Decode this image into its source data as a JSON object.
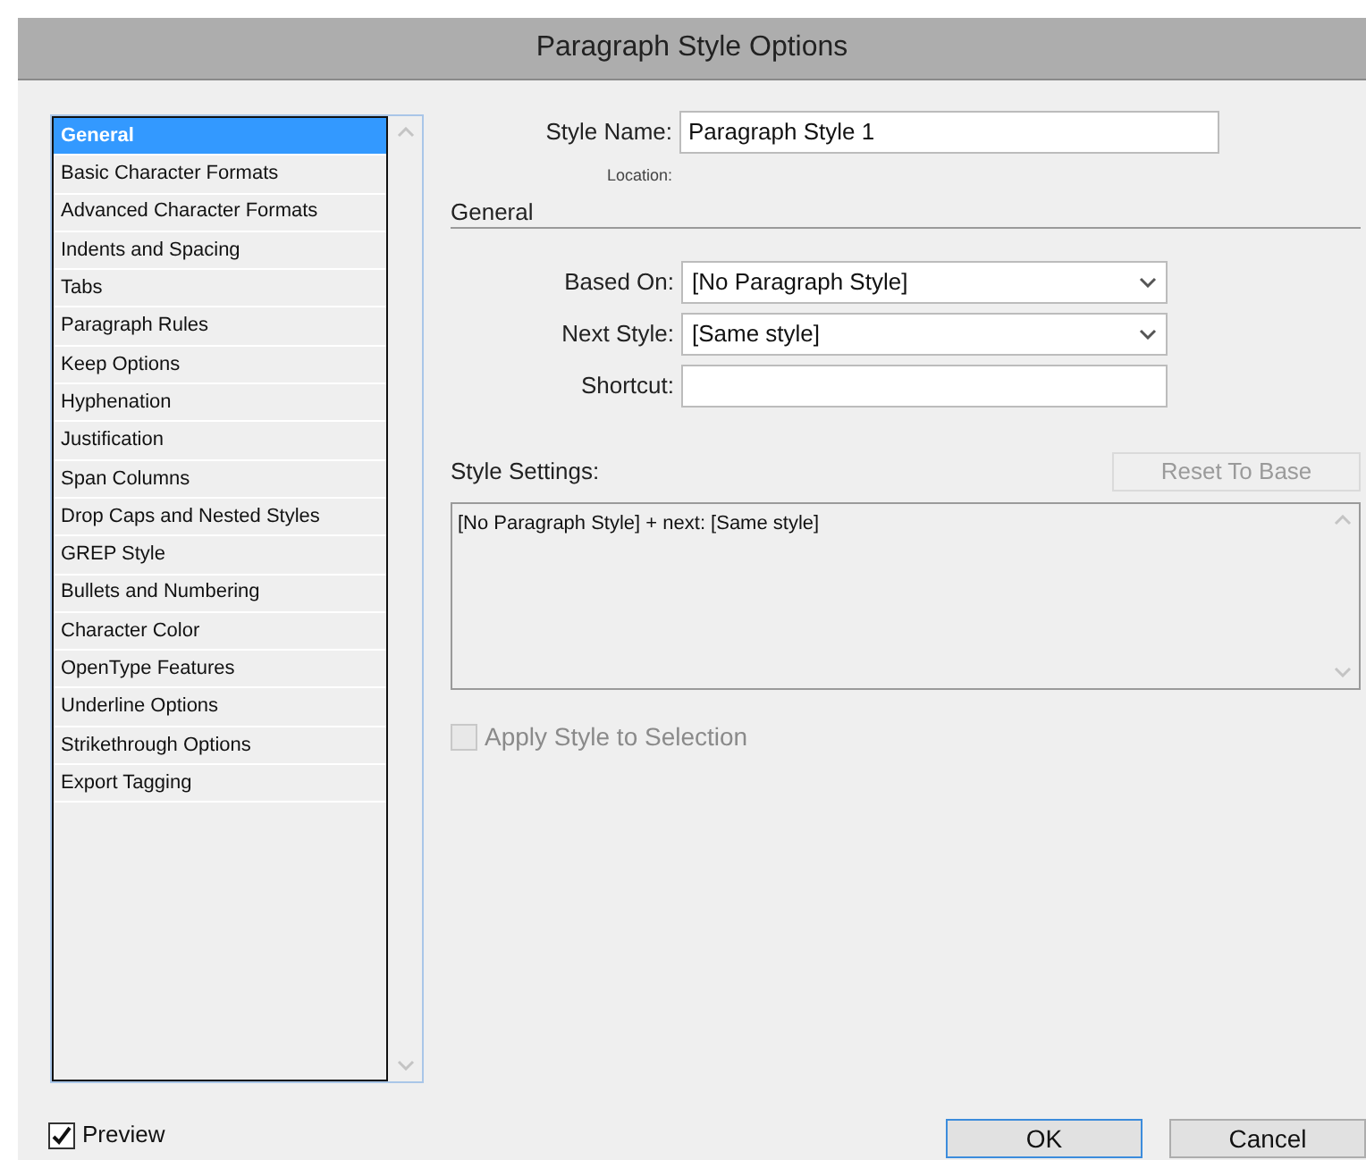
{
  "window": {
    "title": "Paragraph Style Options"
  },
  "sidebar": {
    "items": [
      {
        "label": "General",
        "selected": true
      },
      {
        "label": "Basic Character Formats",
        "selected": false
      },
      {
        "label": "Advanced Character Formats",
        "selected": false
      },
      {
        "label": "Indents and Spacing",
        "selected": false
      },
      {
        "label": "Tabs",
        "selected": false
      },
      {
        "label": "Paragraph Rules",
        "selected": false
      },
      {
        "label": "Keep Options",
        "selected": false
      },
      {
        "label": "Hyphenation",
        "selected": false
      },
      {
        "label": "Justification",
        "selected": false
      },
      {
        "label": "Span Columns",
        "selected": false
      },
      {
        "label": "Drop Caps and Nested Styles",
        "selected": false
      },
      {
        "label": "GREP Style",
        "selected": false
      },
      {
        "label": "Bullets and Numbering",
        "selected": false
      },
      {
        "label": "Character Color",
        "selected": false
      },
      {
        "label": "OpenType Features",
        "selected": false
      },
      {
        "label": "Underline Options",
        "selected": false
      },
      {
        "label": "Strikethrough Options",
        "selected": false
      },
      {
        "label": "Export Tagging",
        "selected": false
      }
    ]
  },
  "style_name": {
    "label": "Style Name:",
    "value": "Paragraph Style 1"
  },
  "location": {
    "label": "Location:"
  },
  "section_title": "General",
  "fields": [
    {
      "kind": "dropdown",
      "label": "Based On:",
      "value": "[No Paragraph Style]"
    },
    {
      "kind": "dropdown",
      "label": "Next Style:",
      "value": "[Same style]"
    },
    {
      "kind": "text",
      "label": "Shortcut:"
    }
  ],
  "style_settings": {
    "label": "Style Settings:",
    "text": "[No Paragraph Style] + next: [Same style]",
    "reset_button": {
      "label": "Reset To Base",
      "disabled": true
    }
  },
  "apply_style": {
    "label": "Apply Style to Selection",
    "checked": false,
    "disabled": true
  },
  "preview": {
    "label": "Preview",
    "checked": true
  },
  "buttons": [
    {
      "label": "OK",
      "default": true
    },
    {
      "label": "Cancel",
      "default": false
    }
  ]
}
